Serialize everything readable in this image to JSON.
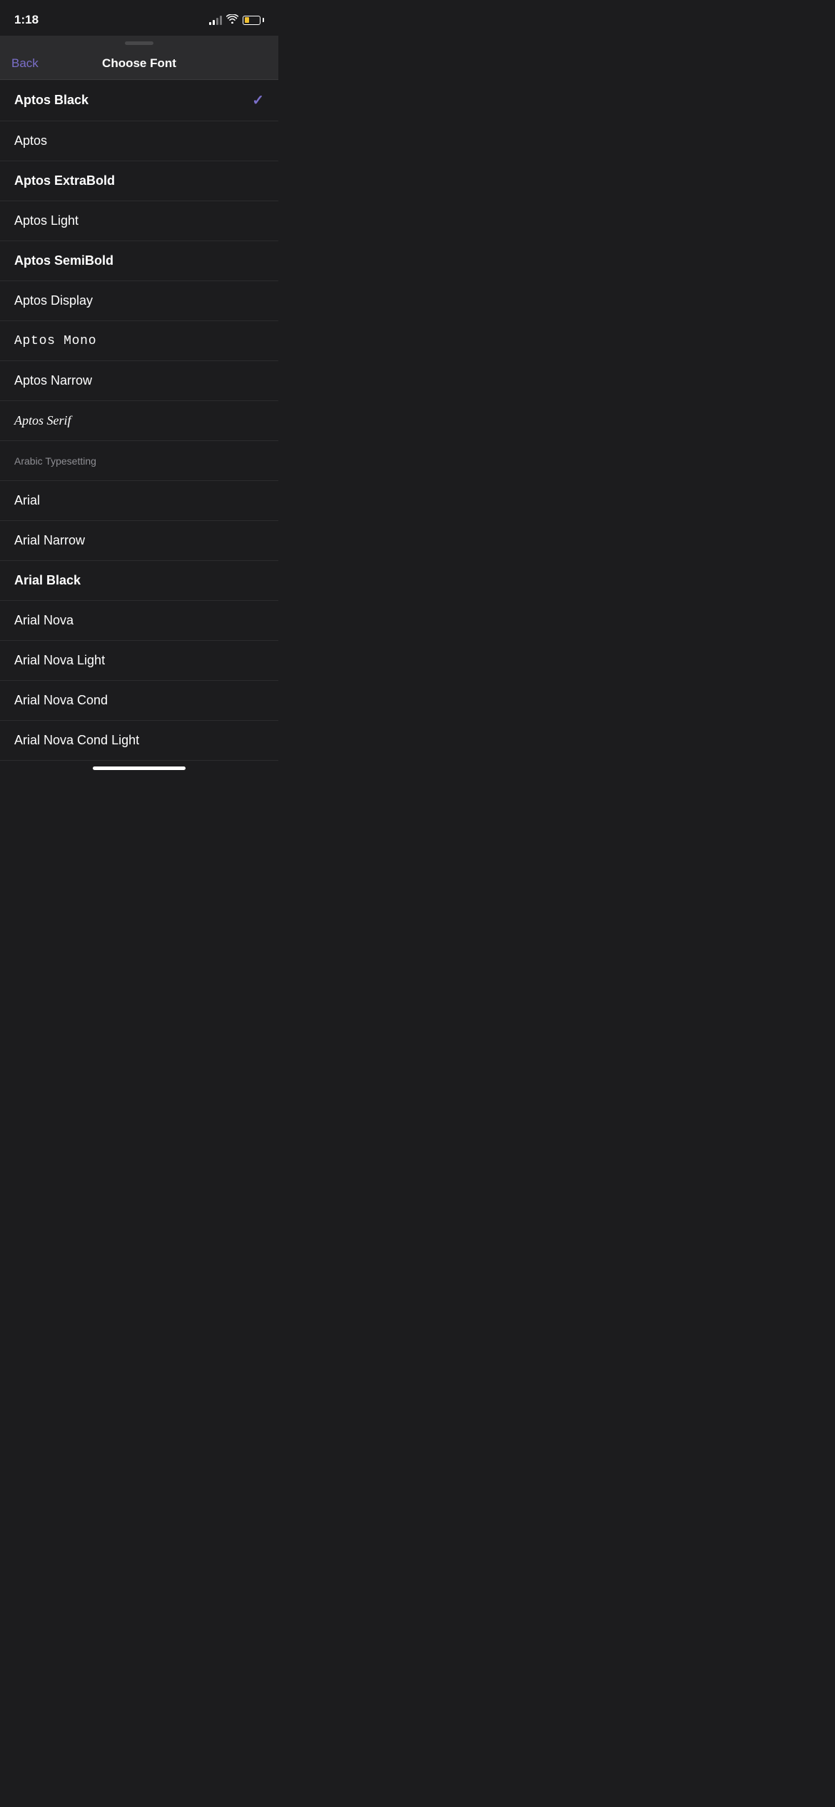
{
  "statusBar": {
    "time": "1:18",
    "batteryColor": "#f0c030"
  },
  "header": {
    "backLabel": "Back",
    "title": "Choose Font"
  },
  "fonts": [
    {
      "id": "aptos-black",
      "name": "Aptos Black",
      "style": "bold",
      "selected": true
    },
    {
      "id": "aptos",
      "name": "Aptos",
      "style": "normal",
      "selected": false
    },
    {
      "id": "aptos-extrabold",
      "name": "Aptos ExtraBold",
      "style": "bold",
      "selected": false
    },
    {
      "id": "aptos-light",
      "name": "Aptos Light",
      "style": "light",
      "selected": false
    },
    {
      "id": "aptos-semibold",
      "name": "Aptos SemiBold",
      "style": "semibold",
      "selected": false
    },
    {
      "id": "aptos-display",
      "name": "Aptos Display",
      "style": "normal",
      "selected": false
    },
    {
      "id": "aptos-mono",
      "name": "Aptos  Mono",
      "style": "aptos-mono",
      "selected": false
    },
    {
      "id": "aptos-narrow",
      "name": "Aptos Narrow",
      "style": "normal",
      "selected": false
    },
    {
      "id": "aptos-serif",
      "name": "Aptos Serif",
      "style": "aptos-serif",
      "selected": false
    },
    {
      "id": "arabic-typesetting",
      "name": "Arabic Typesetting",
      "style": "arabic-typesetting",
      "selected": false
    },
    {
      "id": "arial",
      "name": "Arial",
      "style": "normal",
      "selected": false
    },
    {
      "id": "arial-narrow",
      "name": "Arial Narrow",
      "style": "normal",
      "selected": false
    },
    {
      "id": "arial-black",
      "name": "Arial Black",
      "style": "arial-black",
      "selected": false
    },
    {
      "id": "arial-nova",
      "name": "Arial Nova",
      "style": "normal",
      "selected": false
    },
    {
      "id": "arial-nova-light",
      "name": "Arial Nova Light",
      "style": "light",
      "selected": false
    },
    {
      "id": "arial-nova-cond",
      "name": "Arial Nova Cond",
      "style": "normal",
      "selected": false
    },
    {
      "id": "arial-nova-cond-light",
      "name": "Arial Nova Cond Light",
      "style": "normal",
      "selected": false
    }
  ],
  "checkmark": "✓"
}
